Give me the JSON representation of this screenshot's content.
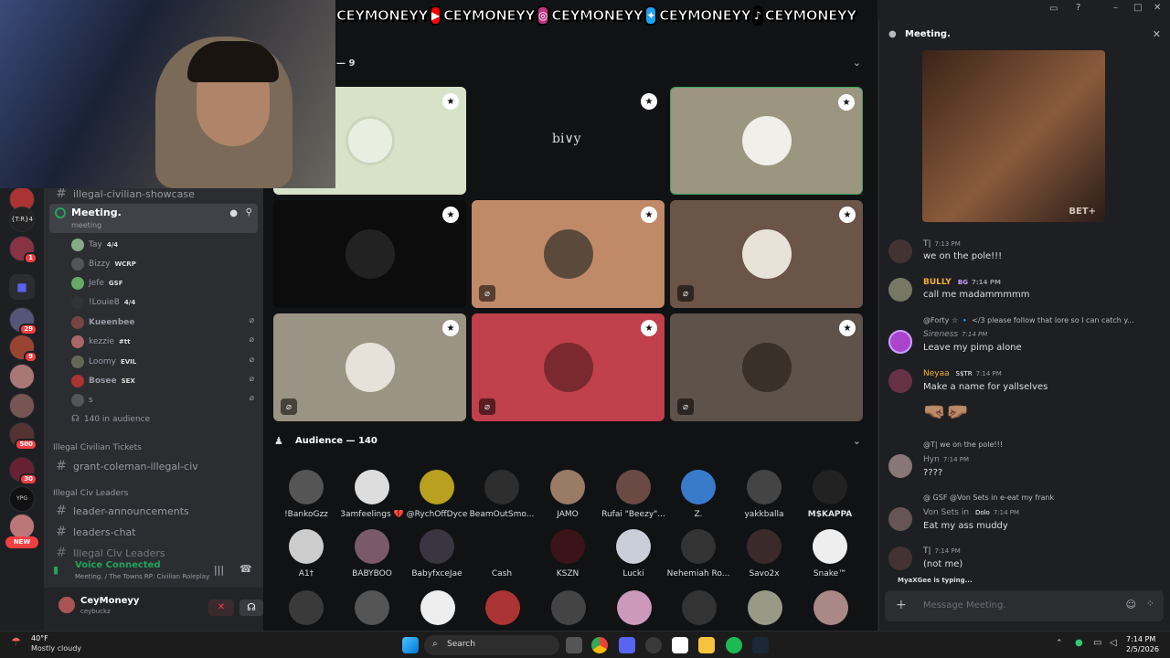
{
  "banner": {
    "handle": "CEYMONEYY"
  },
  "stage": {
    "speakers_header": "— 9",
    "audience_header": "Audience — 140",
    "tile_logo_text": "bi∨y"
  },
  "audience": [
    {
      "name": "!BankoGzz"
    },
    {
      "name": "3amfeelings 💔"
    },
    {
      "name": "@RychOffDyce"
    },
    {
      "name": "BeamOutSmo..."
    },
    {
      "name": "JAMO"
    },
    {
      "name": "Rufai \"Beezy\"..."
    },
    {
      "name": "Z."
    },
    {
      "name": "yakkballa"
    },
    {
      "name": "M$KAPPA"
    },
    {
      "name": "A1†"
    },
    {
      "name": "BABYBOO"
    },
    {
      "name": "BabyfxceJae"
    },
    {
      "name": "Cash"
    },
    {
      "name": "KSZN"
    },
    {
      "name": "Lucki"
    },
    {
      "name": "Nehemiah Ro..."
    },
    {
      "name": "Savo2x"
    },
    {
      "name": "Snake™"
    }
  ],
  "sidebar": {
    "top_channel": "illegal-civilian-showcase",
    "active_channel": "Meeting.",
    "active_sub": "meeting",
    "voice_users": [
      {
        "name": "Tay",
        "tag": "4/4"
      },
      {
        "name": "Bizzy",
        "tag": "WCRP"
      },
      {
        "name": "Jefe",
        "tag": "GSF"
      },
      {
        "name": "!LouieB",
        "tag": "4/4"
      },
      {
        "name": "Kueenbee",
        "tag": ""
      },
      {
        "name": "kezzie",
        "tag": "#tt"
      },
      {
        "name": "Loomy",
        "tag": "EVIL"
      },
      {
        "name": "Bosee",
        "tag": "SEX"
      },
      {
        "name": "s",
        "tag": ""
      }
    ],
    "audience_count": "140 in audience",
    "cat1": "Illegal Civilian Tickets",
    "ch1": "grant-coleman-illegal-civ",
    "cat2": "Illegal Civ Leaders",
    "ch2": "leader-announcements",
    "ch3": "leaders-chat",
    "ch4": "Illegal Civ Leaders",
    "voice_status": "Voice Connected",
    "voice_location": "Meeting. / The Towns RP: Civilian Roleplay",
    "user_name": "CeyMoneyy",
    "user_handle": "ceybuckz"
  },
  "rail_badges": [
    "1",
    "29",
    "9",
    "500",
    "30"
  ],
  "rail_new": "NEW",
  "rail_tags": [
    "{T:R}4",
    "YPG"
  ],
  "chat": {
    "title": "Meeting.",
    "gif_watermark": "BET+",
    "messages": [
      {
        "author": "T|",
        "time": "7:13 PM",
        "text": "we on the pole!!!"
      },
      {
        "author": "BULLY",
        "tag": "BG",
        "time": "7:14 PM",
        "text": "call me madammmmm"
      },
      {
        "reply": "@Forty ☆ 🔹 </3  please follow that lore so I can catch y...",
        "author": "Sireness",
        "time": "7:14 PM",
        "text": "Leave my pimp alone"
      },
      {
        "author": "Neyaa",
        "tag": "S$TR",
        "time": "7:14 PM",
        "text": "Make a name for yallselves",
        "emoji": "🤜🏽🤛🏽"
      },
      {
        "reply": "@T|  we on the pole!!!",
        "author": "Hyn",
        "time": "7:14 PM",
        "text": "????"
      },
      {
        "reply": "@  GSF  @Von Sets in e-eat my frank",
        "author": "Von Sets in",
        "tag": "Dolo",
        "time": "7:14 PM",
        "text": "Eat my ass muddy"
      },
      {
        "author": "T|",
        "time": "7:14 PM",
        "text": "(not me)"
      }
    ],
    "typing": "MyaXGee is typing...",
    "input_placeholder": "Message Meeting."
  },
  "taskbar": {
    "temp": "40°F",
    "weather": "Mostly cloudy",
    "search": "Search",
    "time": "7:14 PM",
    "date": "2/5/2026"
  }
}
